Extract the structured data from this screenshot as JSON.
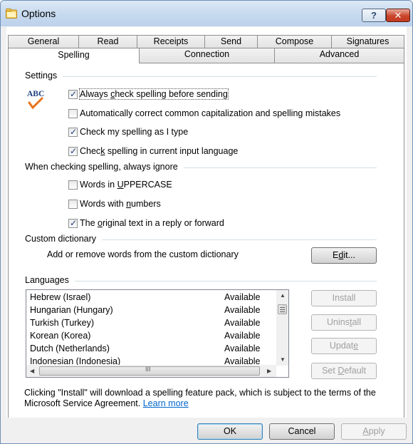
{
  "window": {
    "title": "Options",
    "help_label": "?",
    "close_label": "✕"
  },
  "tabs_row1": [
    "General",
    "Read",
    "Receipts",
    "Send",
    "Compose",
    "Signatures"
  ],
  "tabs_row2": [
    "Spelling",
    "Connection",
    "Advanced"
  ],
  "active_tab": "Spelling",
  "settings": {
    "group_label": "Settings",
    "abc_text": "ABC",
    "options": [
      {
        "pre": "Always ",
        "key": "c",
        "post": "heck spelling before sending",
        "checked": true
      },
      {
        "pre": "Automatically correct common capitalization and spelling mistakes",
        "key": "",
        "post": "",
        "checked": false
      },
      {
        "pre": "Check my spelling as I type",
        "key": "",
        "post": "",
        "checked": true
      },
      {
        "pre": "Chec",
        "key": "k",
        "post": " spelling in current input language",
        "checked": true
      }
    ]
  },
  "ignore": {
    "group_label": "When checking spelling, always ignore",
    "options": [
      {
        "pre": "Words in ",
        "key": "U",
        "post": "PPERCASE",
        "checked": false
      },
      {
        "pre": "Words with ",
        "key": "n",
        "post": "umbers",
        "checked": false
      },
      {
        "pre": "The ",
        "key": "o",
        "post": "riginal text in a reply or forward",
        "checked": true
      }
    ]
  },
  "custom_dictionary": {
    "group_label": "Custom dictionary",
    "description": "Add or remove words from the custom dictionary",
    "edit_pre": "E",
    "edit_key": "d",
    "edit_post": "it..."
  },
  "languages": {
    "group_label": "Languages",
    "rows": [
      {
        "name": "Hebrew (Israel)",
        "status": "Available"
      },
      {
        "name": "Hungarian (Hungary)",
        "status": "Available"
      },
      {
        "name": "Turkish (Turkey)",
        "status": "Available"
      },
      {
        "name": "Korean (Korea)",
        "status": "Available"
      },
      {
        "name": "Dutch (Netherlands)",
        "status": "Available"
      },
      {
        "name": "Indonesian (Indonesia)",
        "status": "Available"
      }
    ],
    "install_label": "Install",
    "uninstall_pre": "Unins",
    "uninstall_key": "t",
    "uninstall_post": "all",
    "update_pre": "Updat",
    "update_key": "e",
    "update_post": "",
    "setdefault_pre": "Set ",
    "setdefault_key": "D",
    "setdefault_post": "efault",
    "hscroll_grip": "III"
  },
  "notice": {
    "text": "Clicking \"Install\" will download a spelling feature pack, which is subject to the terms of the Microsoft Service Agreement. ",
    "link": "Learn more"
  },
  "footer": {
    "ok": "OK",
    "cancel": "Cancel",
    "apply_key": "A",
    "apply_post": "pply"
  },
  "colors": {
    "accent": "#1c3f7d",
    "link": "#0066cc",
    "check_icon": "#e8741c",
    "abc": "#1c3f7d"
  }
}
